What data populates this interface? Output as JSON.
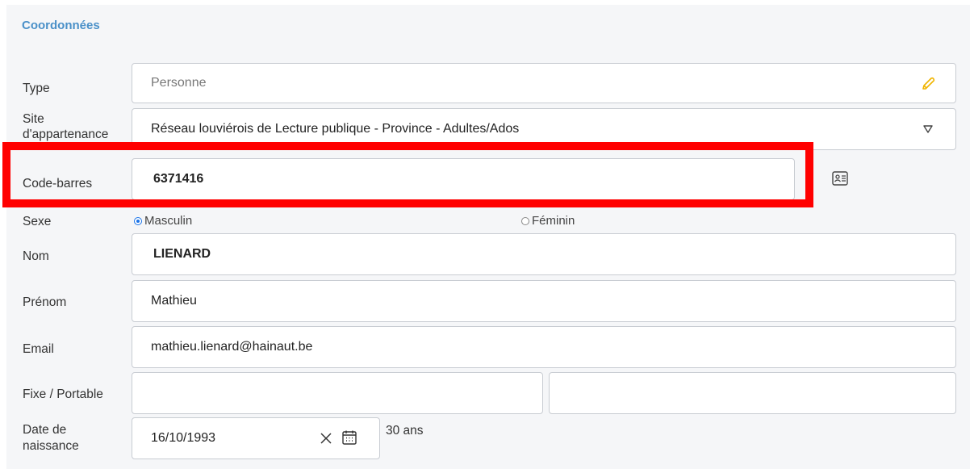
{
  "section": {
    "title": "Coordonnées"
  },
  "fields": {
    "type": {
      "label": "Type",
      "value": "Personne",
      "icon": "pencil-icon"
    },
    "site": {
      "label": "Site\nd'appartenance",
      "value": "Réseau louviérois de Lecture publique - Province - Adultes/Ados",
      "icon": "chevron-down-icon"
    },
    "barcode": {
      "label": "Code-barres",
      "value": "6371416",
      "icon": "id-card-icon"
    },
    "sexe": {
      "label": "Sexe",
      "options": [
        "Masculin",
        "Féminin"
      ],
      "selected": "Masculin"
    },
    "nom": {
      "label": "Nom",
      "value": "LIENARD"
    },
    "prenom": {
      "label": "Prénom",
      "value": "Mathieu"
    },
    "email": {
      "label": "Email",
      "value": "mathieu.lienard@hainaut.be"
    },
    "phone": {
      "label": "Fixe / Portable",
      "fixe": "",
      "portable": ""
    },
    "birth": {
      "label": "Date de\nnaissance",
      "value": "16/10/1993",
      "age": "30 ans"
    }
  },
  "colors": {
    "accent": "#4a90c8",
    "highlight": "#ff0000",
    "radio": "#1a73e8",
    "pencil": "#f0b400"
  }
}
